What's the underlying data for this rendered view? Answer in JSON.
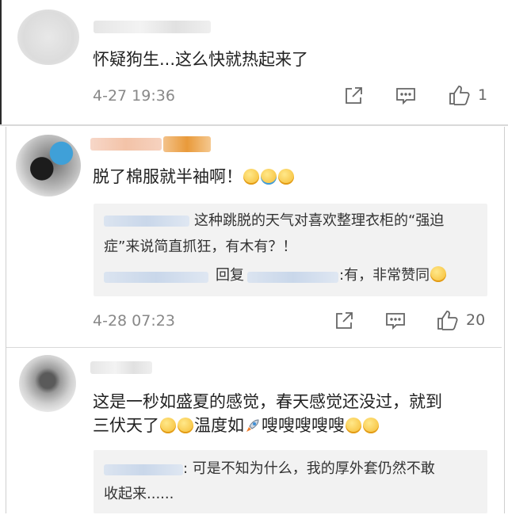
{
  "comments": [
    {
      "text": "怀疑狗生...这么快就热起来了",
      "time": "4-27 19:36",
      "likes": "1"
    },
    {
      "text": "脱了棉服就半袖啊！",
      "time": "4-28 07:23",
      "likes": "20",
      "reply_main": "这种跳脱的天气对喜欢整理衣柜的“强迫",
      "reply_main2": "症”来说简直抓狂，有木有？！",
      "reply_sub_word": "回复",
      "reply_sub_text": ":有，非常赞同"
    },
    {
      "text": "这是一秒如盛夏的感觉，春天感觉还没过，就到",
      "text2_a": "三伏天了",
      "text2_b": "温度如",
      "text2_c": "嗖嗖嗖嗖嗖",
      "reply_text": ": 可是不知为什么，我的厚外套仍然不敢",
      "reply_text2": "收起来......"
    }
  ],
  "icons": {
    "share": "share-icon",
    "comment": "comment-icon",
    "like": "thumbs-up-icon"
  }
}
